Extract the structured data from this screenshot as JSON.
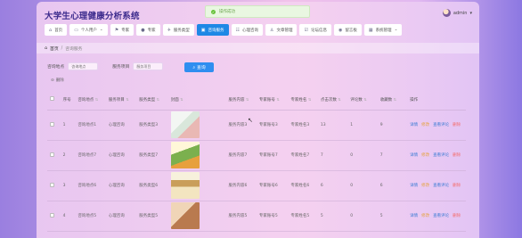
{
  "app": {
    "title": "大学生心理健康分析系统"
  },
  "toast": {
    "text": "操作成功"
  },
  "user": {
    "name": "admin",
    "caret": "▾"
  },
  "nav": [
    {
      "label": "首页",
      "icon": "home-icon"
    },
    {
      "label": "个人用户",
      "icon": "user-card-icon",
      "caret": "⌄"
    },
    {
      "label": "专家",
      "icon": "flag-icon"
    },
    {
      "label": "专家",
      "icon": "user-icon"
    },
    {
      "label": "服务类型",
      "icon": "pin-icon"
    },
    {
      "label": "咨询服务",
      "icon": "monitor-icon",
      "active": true
    },
    {
      "label": "心理咨询",
      "icon": "people-icon"
    },
    {
      "label": "文章管理",
      "icon": "person-icon"
    },
    {
      "label": "论坛信息",
      "icon": "check-square-icon"
    },
    {
      "label": "留言板",
      "icon": "location-icon"
    },
    {
      "label": "系统管理",
      "icon": "grid-icon",
      "caret": "⌄"
    }
  ],
  "breadcrumb": {
    "home": "首页",
    "separator": "/",
    "current": "咨询服务"
  },
  "search": {
    "field1_label": "咨询地点",
    "field1_placeholder": "咨询地点",
    "field2_label": "服务项目",
    "field2_placeholder": "服务项目",
    "button_label": "查询"
  },
  "toolbar": {
    "delete_label": "删除"
  },
  "table": {
    "headers": [
      "序号",
      "咨询地点",
      "服务项目",
      "服务类型",
      "封面",
      "服务内容",
      "专家账号",
      "专家姓名",
      "点击次数",
      "评论数",
      "收藏数",
      "操作"
    ],
    "rows": [
      {
        "no": "1",
        "place": "咨询地点1",
        "item": "心理咨询",
        "type": "服务类型3",
        "content": "服务内容3",
        "acct": "专家账号3",
        "name": "专家姓名3",
        "clicks": "13",
        "comments": "1",
        "favs": "9"
      },
      {
        "no": "2",
        "place": "咨询地点7",
        "item": "心理咨询",
        "type": "服务类型7",
        "content": "服务内容7",
        "acct": "专家账号7",
        "name": "专家姓名7",
        "clicks": "7",
        "comments": "0",
        "favs": "7"
      },
      {
        "no": "3",
        "place": "咨询地点6",
        "item": "心理咨询",
        "type": "服务类型6",
        "content": "服务内容6",
        "acct": "专家账号6",
        "name": "专家姓名6",
        "clicks": "6",
        "comments": "0",
        "favs": "6"
      },
      {
        "no": "4",
        "place": "咨询地点5",
        "item": "心理咨询",
        "type": "服务类型5",
        "content": "服务内容5",
        "acct": "专家账号5",
        "name": "专家姓名5",
        "clicks": "5",
        "comments": "0",
        "favs": "5"
      }
    ],
    "actions": {
      "view": "详情",
      "edit": "修改",
      "comment": "查看评论",
      "delete": "删除"
    }
  }
}
